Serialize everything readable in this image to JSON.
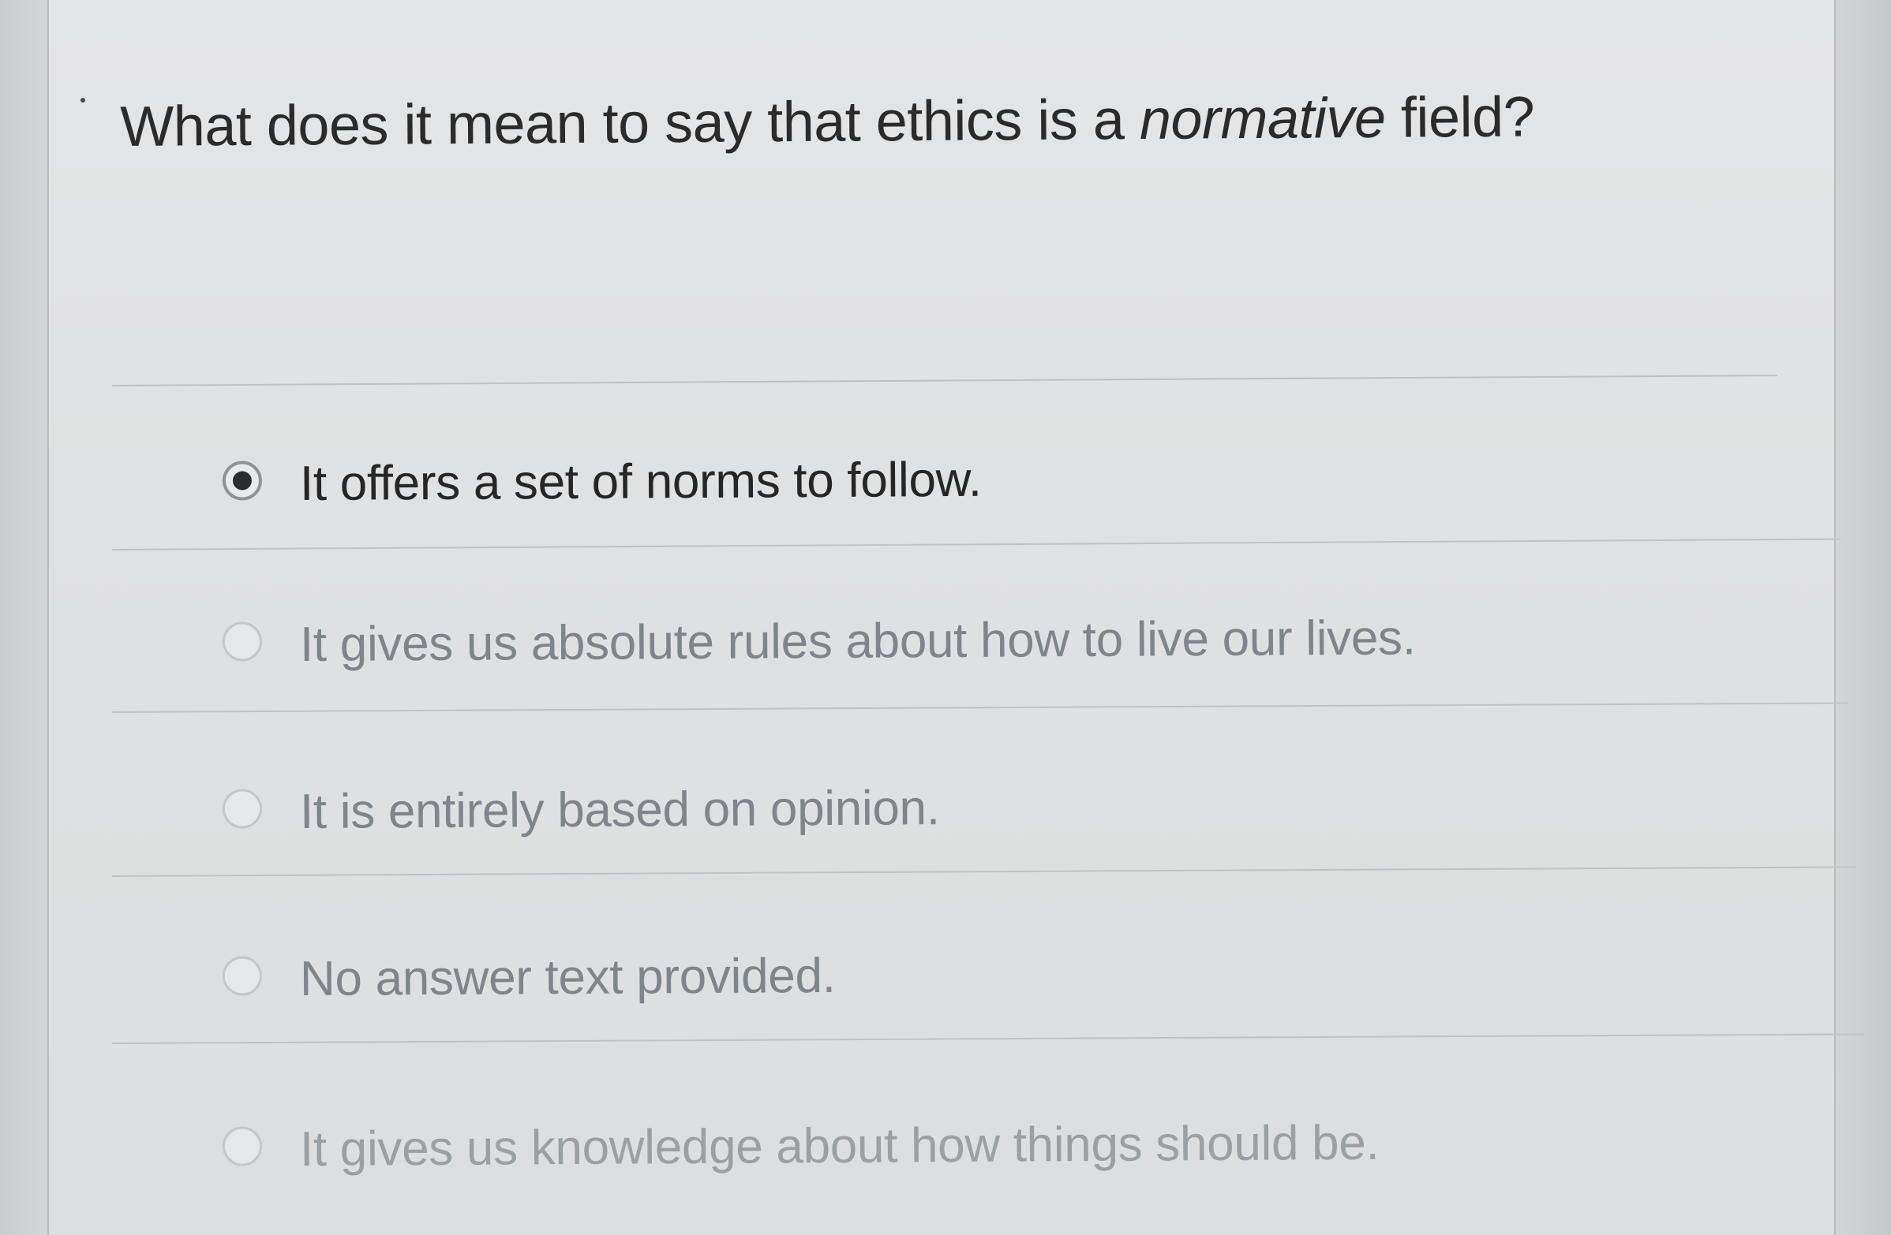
{
  "question": {
    "prefix": "What does it mean to say that ethics is a ",
    "emphasis": "normative",
    "suffix": " field?"
  },
  "options": [
    {
      "label": "It offers a set of norms to follow.",
      "selected": true
    },
    {
      "label": "It gives us absolute rules about how to live our lives.",
      "selected": false
    },
    {
      "label": "It is entirely based on opinion.",
      "selected": false
    },
    {
      "label": "No answer text provided.",
      "selected": false
    },
    {
      "label": "It gives us knowledge about how things should be.",
      "selected": false
    }
  ]
}
